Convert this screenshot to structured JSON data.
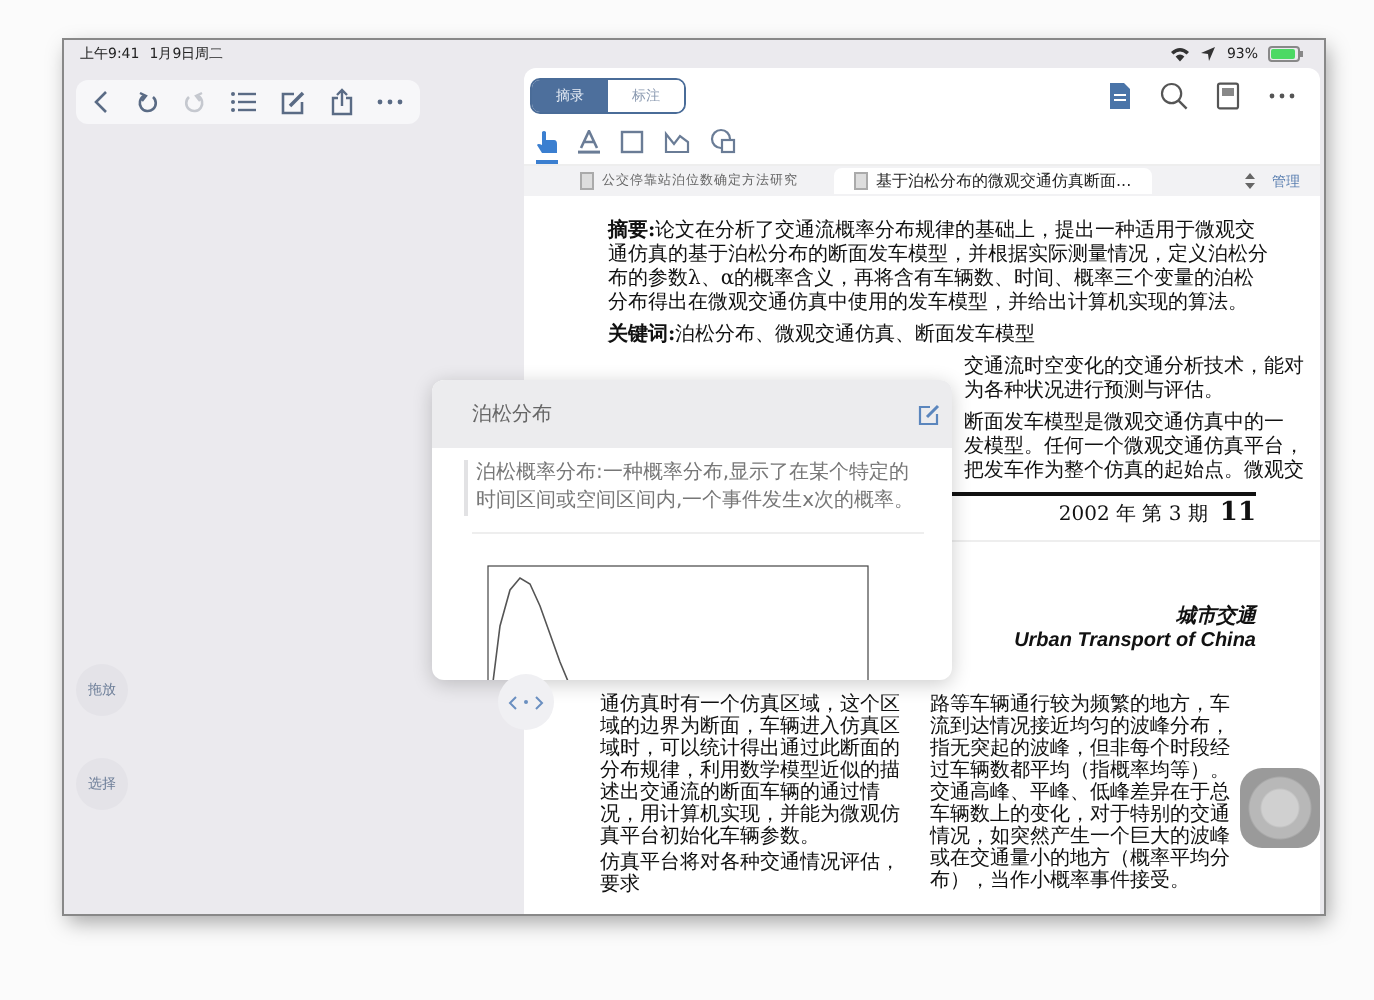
{
  "status_bar": {
    "time": "上午9:41",
    "date": "1月9日周二",
    "battery": "93%"
  },
  "toolbar": [
    {
      "kind": "back",
      "disabled": false
    },
    {
      "kind": "undo",
      "disabled": false
    },
    {
      "kind": "redo",
      "disabled": true
    },
    {
      "kind": "list",
      "disabled": false
    },
    {
      "kind": "edit",
      "disabled": false
    },
    {
      "kind": "share",
      "disabled": false
    },
    {
      "kind": "more",
      "disabled": false
    }
  ],
  "side_buttons": [
    {
      "label": "拖放"
    },
    {
      "label": "选择"
    }
  ],
  "mode_tabs": [
    {
      "label": "摘录",
      "selected": true
    },
    {
      "label": "标注",
      "selected": false
    }
  ],
  "tools": [
    {
      "kind": "hand",
      "selected": true
    },
    {
      "kind": "text",
      "selected": false
    },
    {
      "kind": "rect",
      "selected": false
    },
    {
      "kind": "sign",
      "selected": false
    },
    {
      "kind": "stamp",
      "selected": false
    }
  ],
  "doc_tabs": [
    {
      "title": "公交停靠站泊位数确定方法研究",
      "selected": false
    },
    {
      "title": "基于泊松分布的微观交通仿真断面...",
      "selected": true
    }
  ],
  "manage_link": "管理",
  "document": {
    "abstract": "**摘要:**论文在分析了交通流概率分布规律的基础上，提出一种适用于微观交通仿真的基于泊松分布的断面发车模型，并根据实际测量情况，定义泊松分布的参数λ、α的概率含义，再将含有车辆数、时间、概率三个变量的泊松分布得出在微观交通仿真中使用的发车模型，并给出计算机实现的算法。",
    "keywords": "**关键词:**泊松分布、微观交通仿真、断面发车模型",
    "partial_groups": [
      [
        "交通流时空变化的交通分析技术，能对",
        "为各种状况进行预测与评估。"
      ],
      [
        "断面发车模型是微观交通仿真中的一",
        "发模型。任何一个微观交通仿真平台，",
        "把发车作为整个仿真的起始点。微观交"
      ]
    ],
    "issue": "2002 年 第 3 期",
    "page_number": "11",
    "journal_cn": "城市交通",
    "journal_en": "Urban Transport of China",
    "column_1": [
      "通仿真时有一个仿真区域，这个区域的边界为断面，车辆进入仿真区域时，可以统计得出通过此断面的分布规律，利用数学模型近似的描述出交通流的断面车辆的通过情况，用计算机实现，并能为微观仿真平台初始化车辆参数。",
      "仿真平台将对各种交通情况评估，要求"
    ],
    "column_2": [
      "路等车辆通行较为频繁的地方，车流到达情况接近均匀的波峰分布，指无突起的波峰，但非每个时段经过车辆数都平均（指概率均等）。交通高峰、平峰、低峰差异在于总车辆数上的变化，对于特别的交通情况，如突然产生一个巨大的波峰或在交通量小的地方（概率平均分布），当作小概率事件接受。"
    ]
  },
  "popover": {
    "title": "泊松分布",
    "definition": "泊松概率分布:一种概率分布,显示了在某个特定的时间区间或空间区间内,一个事件发生x次的概率。"
  }
}
